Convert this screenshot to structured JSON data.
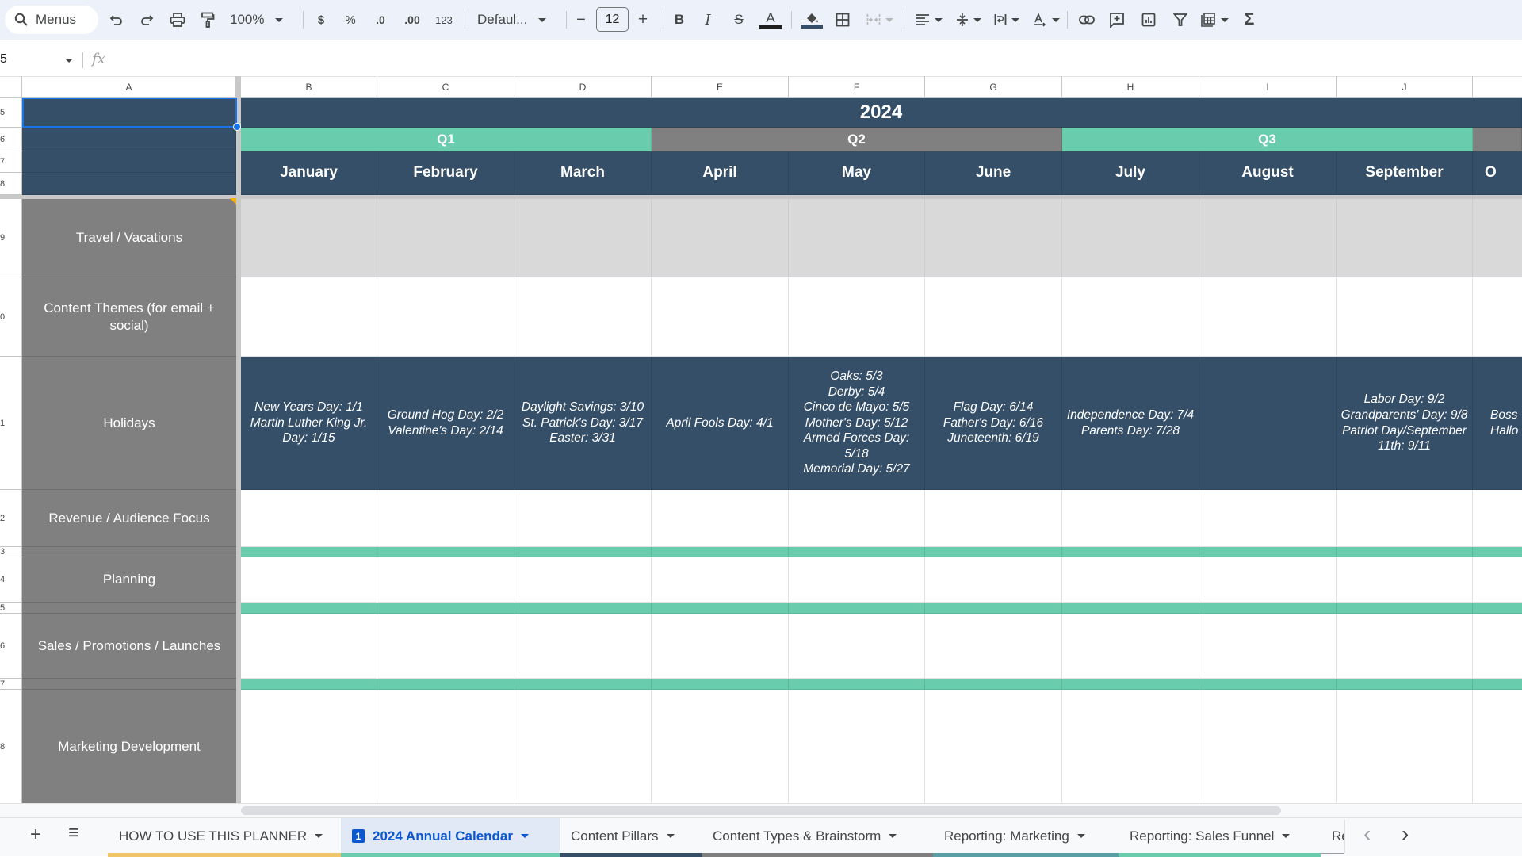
{
  "toolbar": {
    "search_label": "Menus",
    "zoom": "100%",
    "currency": "$",
    "percent": "%",
    "decrease_decimal": ".0",
    "increase_decimal": ".00",
    "number_format": "123",
    "font": "Defaul...",
    "font_size": "12",
    "font_size_minus": "−",
    "font_size_plus": "+",
    "bold": "B",
    "italic": "I",
    "strike": "S",
    "text_color_letter": "A",
    "text_color": "#1f1f1f",
    "fill_color": "#354f69",
    "sum": "Σ"
  },
  "formula_bar": {
    "name_box": "5",
    "fx_label": "fx",
    "value": ""
  },
  "columns": [
    "A",
    "B",
    "C",
    "D",
    "E",
    "F",
    "G",
    "H",
    "I",
    "J",
    ""
  ],
  "row_numbers": [
    "5",
    "6",
    "7",
    "8",
    "9",
    "0",
    "1",
    "2",
    "3",
    "4",
    "5",
    "6",
    "7",
    "8"
  ],
  "calendar": {
    "year": "2024",
    "quarters": [
      "Q1",
      "Q2",
      "Q3"
    ],
    "months": [
      "January",
      "February",
      "March",
      "April",
      "May",
      "June",
      "July",
      "August",
      "September",
      "O"
    ],
    "row_labels": {
      "travel": "Travel / Vacations",
      "content_themes": "Content Themes (for email + social)",
      "holidays": "Holidays",
      "revenue": "Revenue / Audience Focus",
      "planning": "Planning",
      "sales": "Sales / Promotions / Launches",
      "marketing_dev": "Marketing Development"
    },
    "holidays": [
      "New Years Day: 1/1\nMartin Luther King Jr. Day: 1/15",
      "Ground Hog Day: 2/2\nValentine's Day: 2/14",
      "Daylight Savings: 3/10\nSt. Patrick's Day: 3/17\nEaster: 3/31",
      "April Fools Day: 4/1",
      "Oaks: 5/3\nDerby: 5/4\nCinco de Mayo: 5/5\nMother's Day: 5/12\nArmed Forces Day: 5/18\nMemorial Day: 5/27",
      "Flag Day: 6/14\nFather's Day: 6/16\nJuneteenth: 6/19",
      "Independence Day: 7/4\nParents Day: 7/28",
      "",
      "Labor Day: 9/2\nGrandparents' Day: 9/8\nPatriot Day/September 11th: 9/11",
      "Boss\nHallo"
    ],
    "colors": {
      "navy": "#354f69",
      "teal": "#68ccad",
      "grey": "#808080",
      "light_grey": "#d9d9d9"
    }
  },
  "sheet_tabs": [
    {
      "label": "HOW TO USE THIS PLANNER",
      "color": "#f1c66b",
      "active": false
    },
    {
      "label": "2024 Annual Calendar",
      "color": "#68ccad",
      "active": true,
      "badge": "1"
    },
    {
      "label": "Content Pillars",
      "color": "#354f69",
      "active": false
    },
    {
      "label": "Content Types & Brainstorm",
      "color": "#7f7f7f",
      "active": false
    },
    {
      "label": "Reporting: Marketing",
      "color": "#5a9ea6",
      "active": false
    },
    {
      "label": "Reporting: Sales Funnel",
      "color": "#68ccad",
      "active": false
    },
    {
      "label": "Re",
      "color": "#9aa0a6",
      "active": false
    }
  ],
  "tabbar": {
    "add_sheet": "+",
    "all_sheets": "≡",
    "prev": "‹",
    "next": "›"
  }
}
